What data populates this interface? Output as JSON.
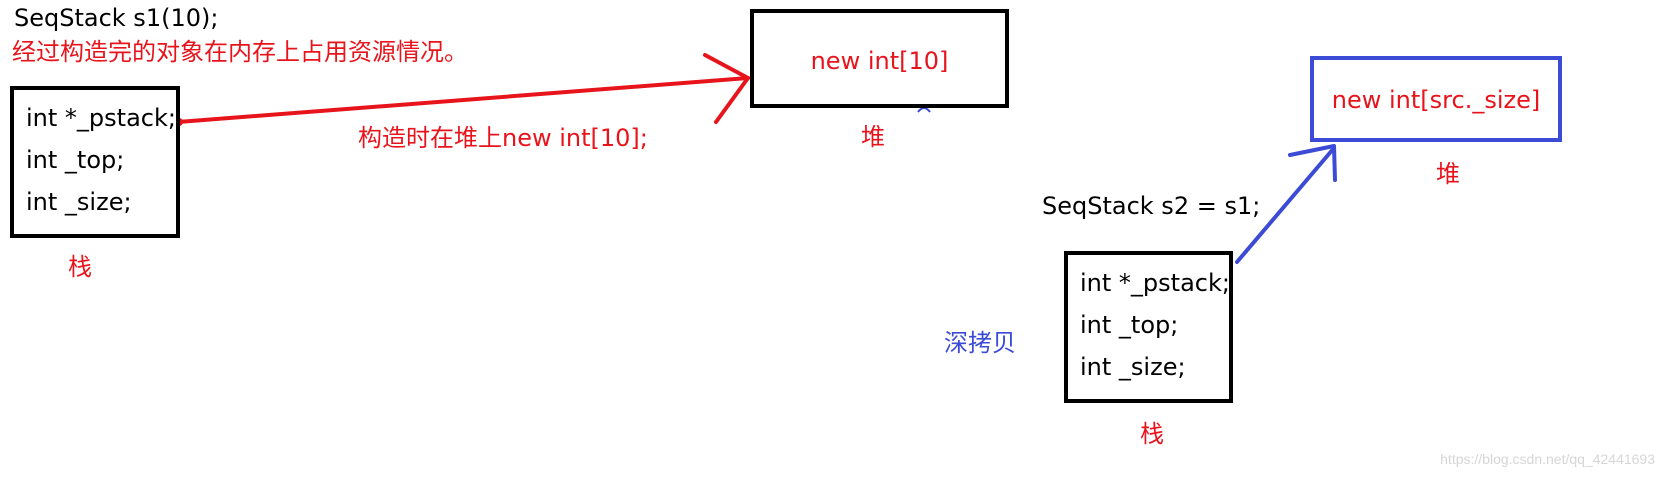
{
  "colors": {
    "red": "#e8141c",
    "blue": "#3b4bd6",
    "black": "#000000"
  },
  "s1": {
    "declaration": "SeqStack s1(10);",
    "caption": "经过构造完的对象在内存上占用资源情况。",
    "fields": [
      "int *_pstack;",
      "int _top;",
      "int _size;"
    ],
    "stack_label": "栈"
  },
  "heap1": {
    "text": "new int[10]",
    "label": "堆"
  },
  "arrow1_label": "构造时在堆上new int[10];",
  "s2": {
    "declaration": "SeqStack s2 = s1;",
    "fields": [
      "int *_pstack;",
      "int _top;",
      "int _size;"
    ],
    "stack_label": "栈"
  },
  "heap2": {
    "text": "new int[src._size]",
    "label": "堆"
  },
  "deep_copy_label": "深拷贝",
  "watermark": "https://blog.csdn.net/qq_42441693"
}
